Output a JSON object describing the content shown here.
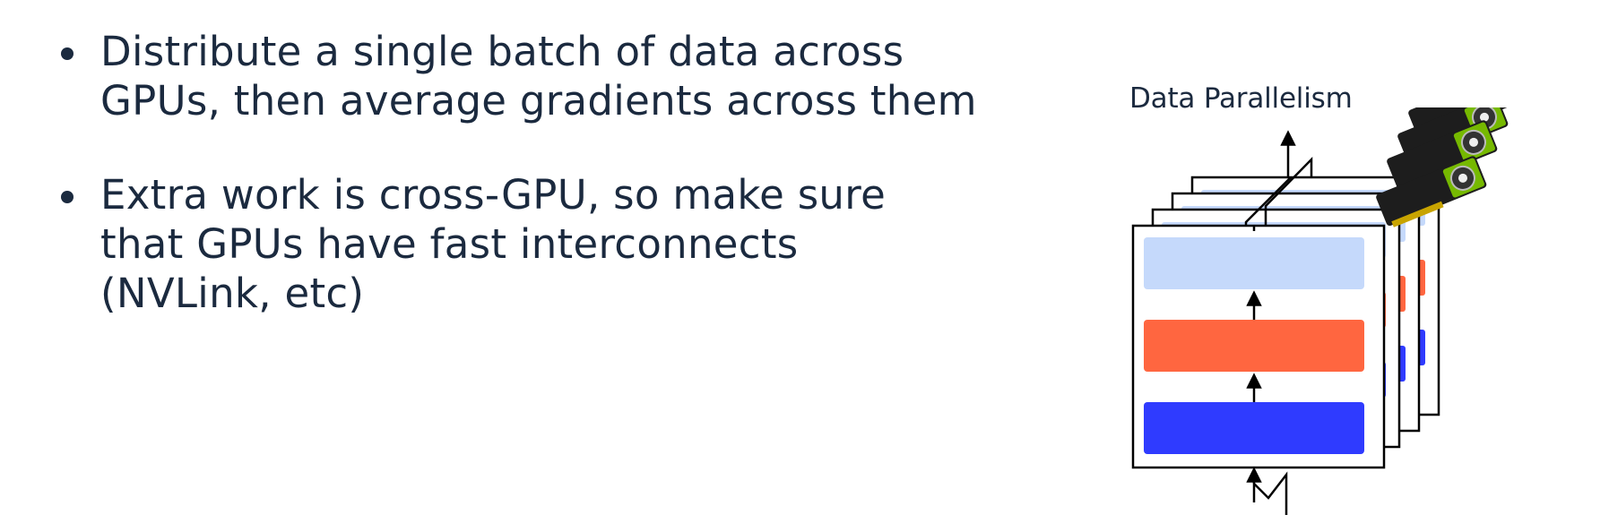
{
  "bullets": [
    {
      "lines": [
        "Distribute a single batch of data across",
        "GPUs, then average gradients across them"
      ]
    },
    {
      "lines": [
        "Extra work is cross-GPU, so make sure",
        "that GPUs have fast interconnects",
        "(NVLink, etc)"
      ]
    }
  ],
  "figure": {
    "title": "Data Parallelism",
    "layer_colors": {
      "top": "#c5d9fb",
      "middle": "#ff6640",
      "bottom": "#2f3bff"
    },
    "gpu_card_icon": "gpu-card-icon",
    "text_color": "#1b2a3f"
  }
}
